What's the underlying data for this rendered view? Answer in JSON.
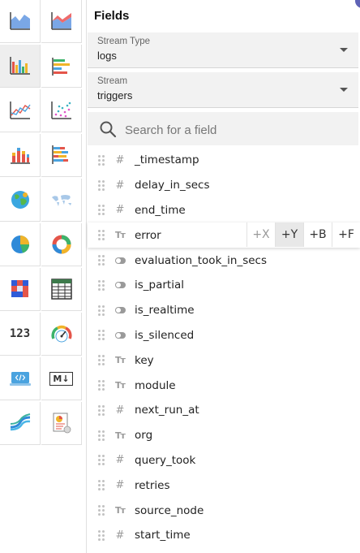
{
  "panel": {
    "title": "Fields"
  },
  "stream_type": {
    "label": "Stream Type",
    "value": "logs"
  },
  "stream": {
    "label": "Stream",
    "value": "triggers"
  },
  "search": {
    "placeholder": "Search for a field"
  },
  "chart_types": [
    "area",
    "area-stacked",
    "bar",
    "h-bar",
    "line",
    "scatter",
    "stacked",
    "h-stacked",
    "geomap",
    "maps",
    "pie",
    "donut",
    "heatmap",
    "table",
    "metric",
    "gauge",
    "html",
    "markdown",
    "sankey",
    "custom-chart"
  ],
  "selected_chart": "bar",
  "metric_text": "123",
  "markdown_text": "M↓",
  "axis_buttons": [
    "+X",
    "+Y",
    "+B",
    "+F"
  ],
  "fields": [
    {
      "name": "_timestamp",
      "type": "number"
    },
    {
      "name": "delay_in_secs",
      "type": "number"
    },
    {
      "name": "end_time",
      "type": "number"
    },
    {
      "name": "error",
      "type": "text",
      "hovered": true
    },
    {
      "name": "evaluation_took_in_secs",
      "type": "boolean"
    },
    {
      "name": "is_partial",
      "type": "boolean"
    },
    {
      "name": "is_realtime",
      "type": "boolean"
    },
    {
      "name": "is_silenced",
      "type": "boolean"
    },
    {
      "name": "key",
      "type": "text"
    },
    {
      "name": "module",
      "type": "text"
    },
    {
      "name": "next_run_at",
      "type": "number"
    },
    {
      "name": "org",
      "type": "text"
    },
    {
      "name": "query_took",
      "type": "number"
    },
    {
      "name": "retries",
      "type": "number"
    },
    {
      "name": "source_node",
      "type": "text"
    },
    {
      "name": "start_time",
      "type": "number"
    }
  ]
}
